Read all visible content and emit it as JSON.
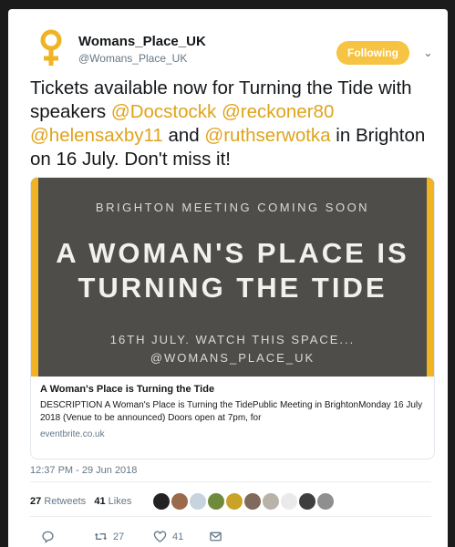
{
  "author": {
    "name": "Womans_Place_UK",
    "handle": "@Womans_Place_UK",
    "avatar_color": "#f0b323"
  },
  "follow_button": {
    "label": "Following",
    "color": "#f6c343"
  },
  "menu": {
    "icon": "chevron-down-icon"
  },
  "tweet": {
    "text_1": "Tickets available now for Turning the Tide with speakers ",
    "mention_1": "@Docstockk",
    "space_1": " ",
    "mention_2": "@reckoner80",
    "space_2": " ",
    "mention_3": "@helensaxby11",
    "text_2": " and ",
    "mention_4": "@ruthserwotka",
    "text_3": " in Brighton on 16 July.   Don't miss it!"
  },
  "banner": {
    "top_line": "BRIGHTON MEETING COMING SOON",
    "headline_1": "A WOMAN'S PLACE IS",
    "headline_2": "TURNING THE TIDE",
    "bottom_line_1": "16TH JULY. WATCH THIS SPACE...",
    "bottom_line_2": "@WOMANS_PLACE_UK",
    "background": "#4e4d4a",
    "accent": "#f0b323"
  },
  "link_card": {
    "title": "A Woman's Place is Turning the Tide",
    "description": "DESCRIPTION A Woman's Place is Turning the TidePublic Meeting in BrightonMonday 16 July 2018 (Venue to be announced) Doors open at 7pm, for",
    "domain": "eventbrite.co.uk"
  },
  "timestamp": "12:37 PM - 29 Jun 2018",
  "stats": {
    "retweets_count": "27",
    "retweets_label": "Retweets",
    "likes_count": "41",
    "likes_label": "Likes"
  },
  "likers": [
    {
      "color": "#222222",
      "icon": "user-avatar"
    },
    {
      "color": "#9b6a4a",
      "icon": "user-avatar"
    },
    {
      "color": "#c7d3de",
      "icon": "default-avatar"
    },
    {
      "color": "#6f8a3a",
      "icon": "user-avatar"
    },
    {
      "color": "#c9a227",
      "icon": "user-avatar"
    },
    {
      "color": "#7f6a5c",
      "icon": "user-avatar"
    },
    {
      "color": "#b8b2a8",
      "icon": "user-avatar"
    },
    {
      "color": "#eaeaea",
      "icon": "user-avatar"
    },
    {
      "color": "#3e3e3e",
      "icon": "user-avatar"
    },
    {
      "color": "#8f8f8f",
      "icon": "user-avatar"
    }
  ],
  "actions": {
    "reply": {
      "icon": "reply-icon",
      "count": ""
    },
    "retweet": {
      "icon": "retweet-icon",
      "count": "27"
    },
    "like": {
      "icon": "heart-icon",
      "count": "41"
    },
    "message": {
      "icon": "envelope-icon",
      "count": ""
    }
  }
}
